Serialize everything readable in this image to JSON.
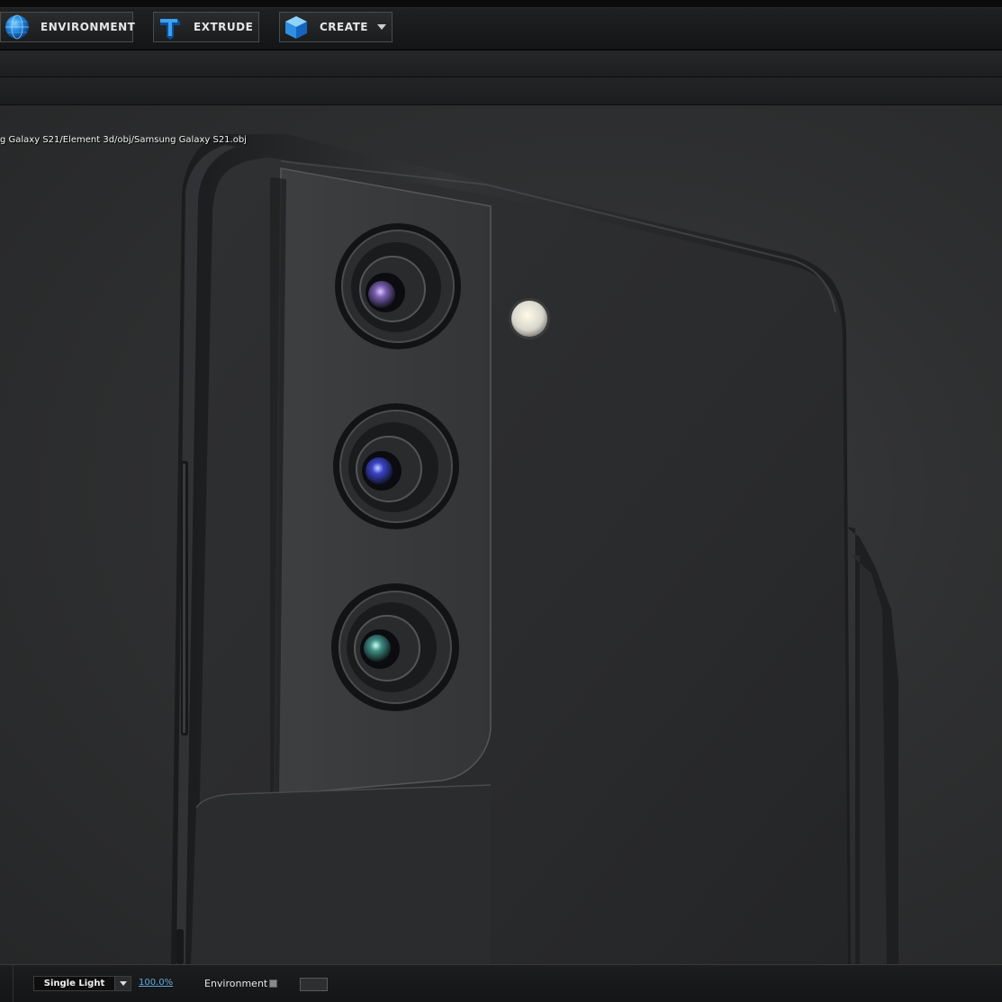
{
  "toolbar": {
    "environment_label": "ENVIRONMENT",
    "extrude_label": "EXTRUDE",
    "create_label": "CREATE"
  },
  "viewport": {
    "file_path": "g Galaxy S21/Element 3d/obj/Samsung Galaxy S21.obj"
  },
  "statusbar": {
    "light_mode": "Single Light",
    "zoom": "100.0%",
    "environment_label": "Environment"
  },
  "colors": {
    "accent_blue": "#1e88e5",
    "zoom_link": "#5fa7e0",
    "phone_body": "#2a2b2d"
  },
  "icons": {
    "environment": "globe-icon",
    "extrude": "extrude-t-icon",
    "create": "cube-icon"
  }
}
